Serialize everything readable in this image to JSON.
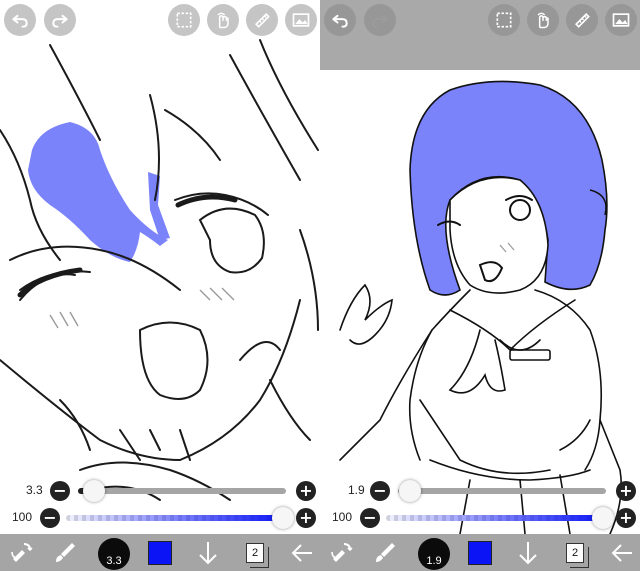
{
  "colors": {
    "hair_fill": "#7b83fb",
    "primary_color": "#0a14f5",
    "toolbar_bg": "#a5a5a5",
    "topbar_overlay": "#a9a9a9"
  },
  "left": {
    "top_icons": [
      "undo-icon",
      "redo-icon",
      "selection-icon",
      "finger-icon",
      "ruler-icon",
      "canvas-icon"
    ],
    "brush_size_slider": {
      "value_label": "3.3",
      "level": 0.05
    },
    "opacity_slider": {
      "value_label": "100",
      "level": 1.0
    },
    "toolbar": {
      "brush_size_label": "3.3",
      "layer_count": "2"
    }
  },
  "right": {
    "top_icons": [
      "undo-icon",
      "redo-icon",
      "selection-icon",
      "finger-icon",
      "ruler-icon",
      "canvas-icon"
    ],
    "brush_size_slider": {
      "value_label": "1.9",
      "level": 0.03
    },
    "opacity_slider": {
      "value_label": "100",
      "level": 1.0
    },
    "toolbar": {
      "brush_size_label": "1.9",
      "layer_count": "2"
    }
  }
}
